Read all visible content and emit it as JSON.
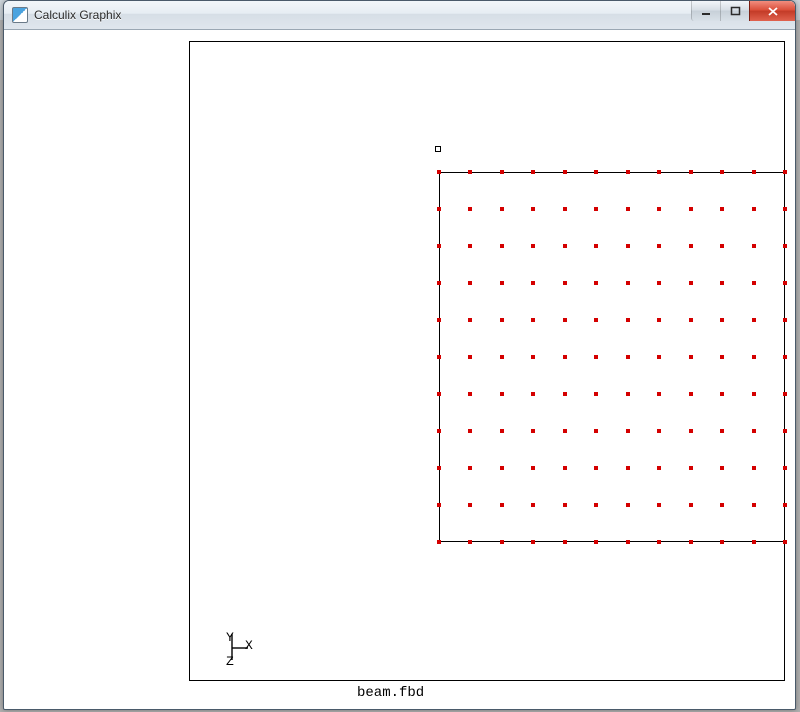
{
  "window": {
    "title": "Calculix Graphix"
  },
  "viewport": {
    "filename": "beam.fbd",
    "axes": {
      "y": "Y",
      "x": "X",
      "z": "Z"
    },
    "floating_node_label": "",
    "mesh": {
      "rows": 11,
      "cols": 12,
      "node_color": "#d40000"
    }
  },
  "win_controls": {
    "minimize_tooltip": "Minimize",
    "maximize_tooltip": "Maximize",
    "close_tooltip": "Close"
  }
}
